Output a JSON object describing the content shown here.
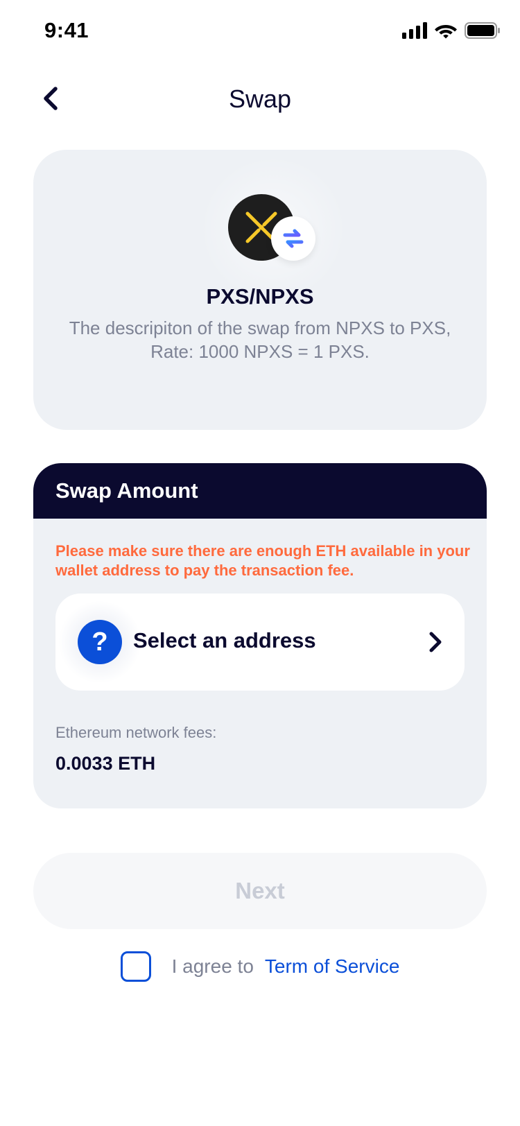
{
  "status_bar": {
    "time": "9:41",
    "icons": [
      "cellular-signal-icon",
      "wifi-icon",
      "battery-icon"
    ]
  },
  "nav": {
    "title": "Swap",
    "back_icon": "chevron-left-icon"
  },
  "swap_info": {
    "icons": [
      "pundi-x-coin-icon",
      "swap-arrows-icon"
    ],
    "pair": "PXS/NPXS",
    "description_line1": "The descripiton of the swap from NPXS to PXS,",
    "description_line2": "Rate: 1000 NPXS = 1 PXS."
  },
  "swap_amount": {
    "header": "Swap Amount",
    "warning": "Please make sure there are enough ETH available in your wallet address to pay the transaction fee.",
    "address_select": {
      "icon": "question-icon",
      "icon_glyph": "?",
      "label": "Select an address",
      "chevron": "chevron-right-icon"
    },
    "fees_label": "Ethereum network fees:",
    "fees_value": "0.0033 ETH"
  },
  "next_button": {
    "label": "Next",
    "enabled": false
  },
  "agreement": {
    "checked": false,
    "text": "I agree to",
    "link": "Term of Service"
  },
  "colors": {
    "primary_dark": "#0b0a2f",
    "accent_blue": "#0b4fd8",
    "warning_orange": "#ff6a3d",
    "card_bg": "#eef1f5",
    "muted_text": "#7d8294",
    "disabled_text": "#c8ccd6",
    "coin_yellow": "#f6c829"
  }
}
